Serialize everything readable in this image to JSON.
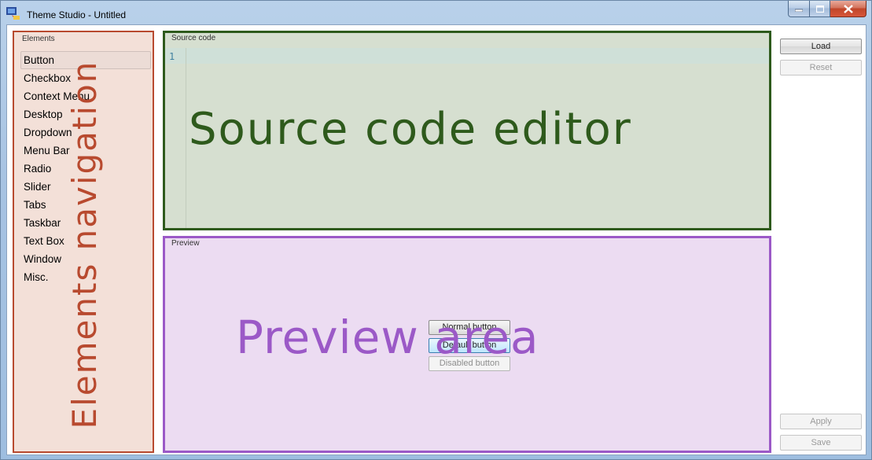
{
  "window": {
    "title": "Theme Studio - Untitled"
  },
  "elements_panel": {
    "label": "Elements",
    "items": [
      {
        "label": "Button",
        "selected": true
      },
      {
        "label": "Checkbox"
      },
      {
        "label": "Context Menu"
      },
      {
        "label": "Desktop"
      },
      {
        "label": "Dropdown"
      },
      {
        "label": "Menu Bar"
      },
      {
        "label": "Radio"
      },
      {
        "label": "Slider"
      },
      {
        "label": "Tabs"
      },
      {
        "label": "Taskbar"
      },
      {
        "label": "Text Box"
      },
      {
        "label": "Window"
      },
      {
        "label": "Misc."
      }
    ],
    "annotation": "Elements navigation"
  },
  "source_panel": {
    "label": "Source code",
    "line_number": "1",
    "annotation": "Source code editor"
  },
  "preview_panel": {
    "label": "Preview",
    "normal_button": "Normal button",
    "default_button": "Default button",
    "disabled_button": "Disabled button",
    "annotation": "Preview area"
  },
  "actions": {
    "load": "Load",
    "reset": "Reset",
    "apply": "Apply",
    "save": "Save"
  },
  "colors": {
    "elements_annotation": "#b84a2f",
    "source_annotation": "#2e5a1c",
    "preview_annotation": "#9b59c7"
  }
}
